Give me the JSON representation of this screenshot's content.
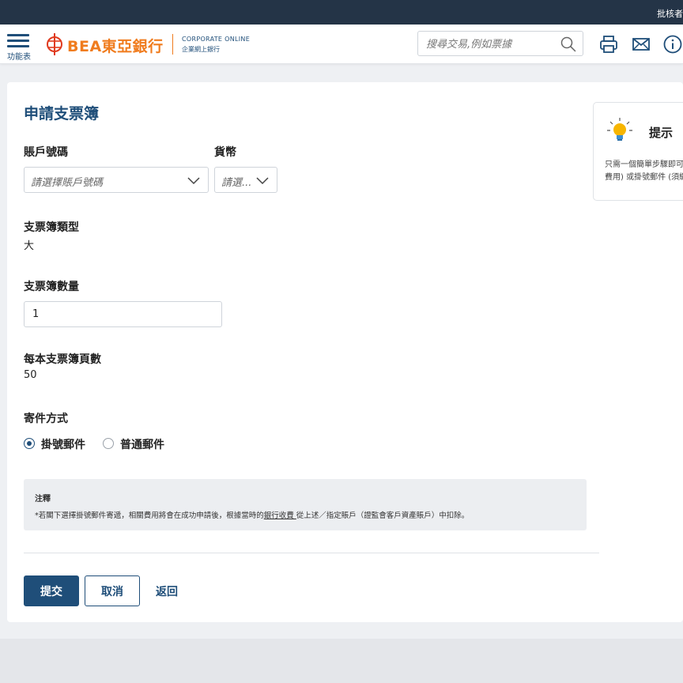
{
  "topbar": {
    "right_text": "批核者"
  },
  "header": {
    "menu_label": "功能表",
    "logo_brand": "BEA東亞銀行",
    "logo_line1": "CORPORATE ONLINE",
    "logo_line2": "企業網上銀行",
    "search_placeholder": "搜尋交易,例如票據",
    "icons": [
      "print-icon",
      "mail-icon",
      "info-icon"
    ]
  },
  "page": {
    "title": "申請支票簿",
    "account": {
      "label": "賬戶號碼",
      "placeholder": "請選擇賬戶號碼"
    },
    "currency": {
      "label": "貨幣",
      "placeholder": "請選..."
    },
    "chequebook_type": {
      "label": "支票簿類型",
      "value": "大"
    },
    "quantity": {
      "label": "支票簿數量",
      "value": "1"
    },
    "pages_per_book": {
      "label": "每本支票簿頁數",
      "value": "50"
    },
    "delivery": {
      "label": "寄件方式",
      "options": [
        {
          "label": "掛號郵件",
          "selected": true
        },
        {
          "label": "普通郵件",
          "selected": false
        }
      ]
    },
    "note": {
      "title": "注釋",
      "text_before": "*若閣下選擇掛號郵件寄遞，相關費用將會在成功申請後，根據當時的",
      "link": "銀行收費 ",
      "text_after": "從上述／指定賬戶（證監會客戶資產賬戶）中扣除。"
    },
    "buttons": {
      "submit": "提交",
      "cancel": "取消",
      "back": "返回"
    }
  },
  "tip": {
    "title": "提示",
    "line1": "只需一個簡單步驟即可",
    "line2": "費用) 或掛號郵件 (須繳"
  },
  "colors": {
    "brand_blue": "#1f4e79",
    "brand_orange": "#f07c1e",
    "topbar": "#243447"
  }
}
